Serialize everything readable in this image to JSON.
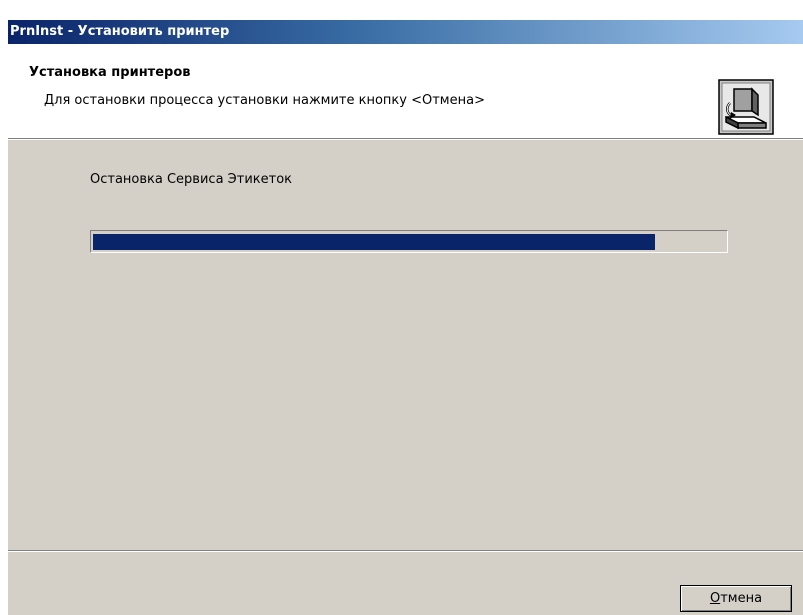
{
  "window": {
    "title": "PrnInst - Установить принтер"
  },
  "header": {
    "title": "Установка принтеров",
    "subtitle": "Для остановки процесса установки нажмите кнопку <Отмена>",
    "icon": "printer-install-icon"
  },
  "main": {
    "status_text": "Остановка Сервиса Этикеток",
    "progress_percent": 89
  },
  "footer": {
    "cancel_mnemonic": "О",
    "cancel_rest": "тмена"
  },
  "colors": {
    "progress_fill": "#0a246a",
    "titlebar_start": "#0a246a",
    "titlebar_end": "#a6caf0",
    "face": "#d4d0c8"
  }
}
